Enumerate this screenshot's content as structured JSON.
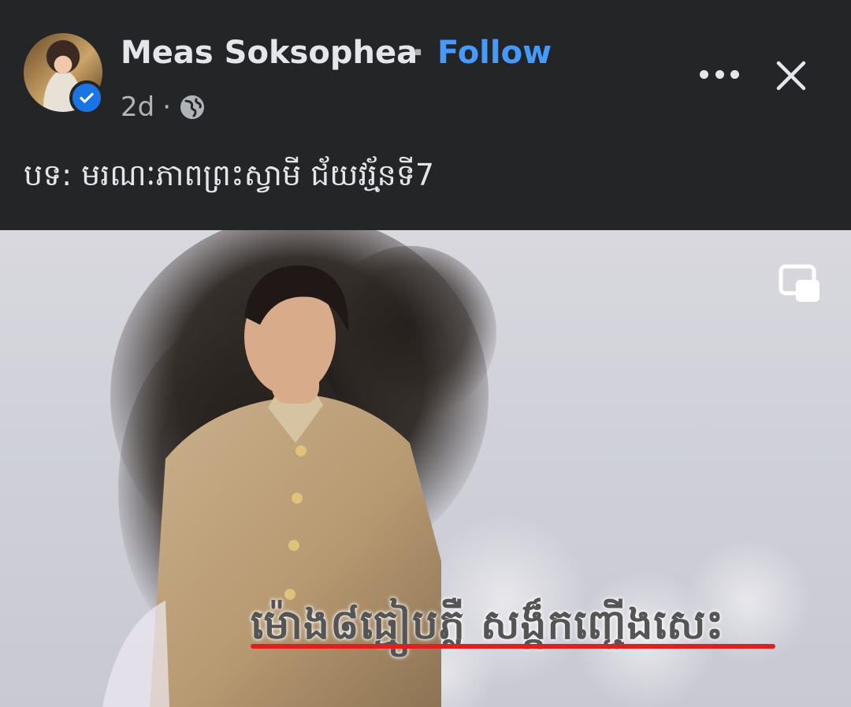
{
  "post": {
    "author_name": "Meas Soksophea",
    "separator": "·",
    "follow_label": "Follow",
    "age": "2d",
    "age_separator": "·",
    "caption": "បទ: មរណៈភាពព្រះស្វាមី ជ័យវរ្ម័នទី7",
    "verified": true
  },
  "header_actions": {
    "more_icon": "more-horizontal-icon",
    "close_icon": "close-icon"
  },
  "media": {
    "overlay_text": "ម៉ោង៨ធ្មៀបភ្លឺ សង្ក៏កញ្ជើងសេះ",
    "pip_icon": "picture-in-picture-icon"
  },
  "colors": {
    "background": "#242526",
    "text_primary": "#e4e6eb",
    "text_secondary": "#b0b3b8",
    "follow_blue": "#4599ff",
    "verified_blue": "#1b74e4",
    "underline_red": "#e01f1f"
  }
}
